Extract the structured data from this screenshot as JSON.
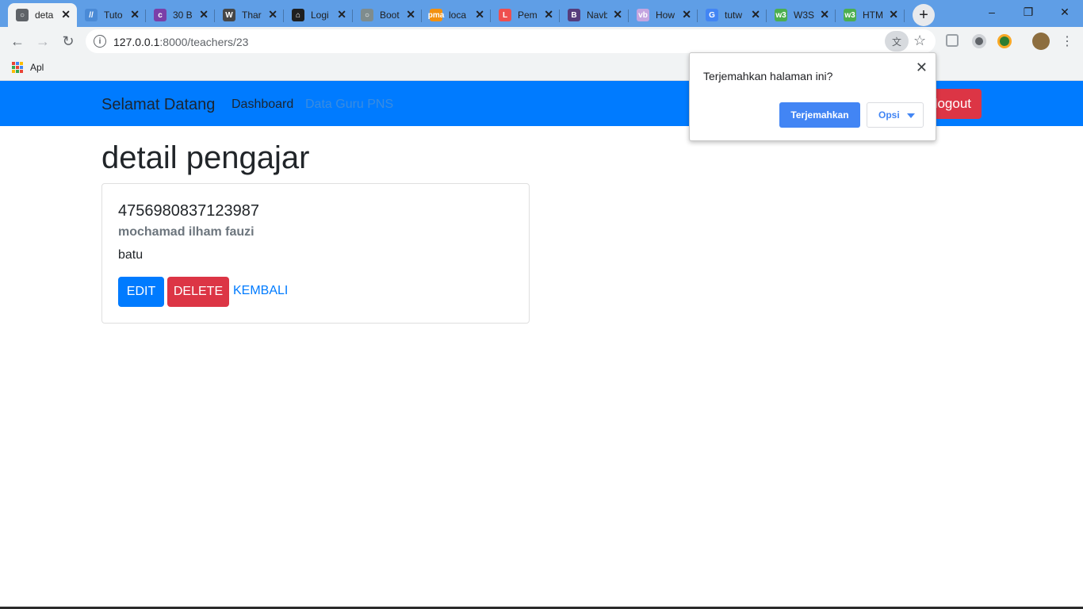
{
  "browser": {
    "tabs": [
      {
        "title": "deta",
        "icon": "globe-icon",
        "color": "#5f6368",
        "active": true
      },
      {
        "title": "Tuto",
        "icon": "wordpress-code-icon",
        "color": "#4a8ad6"
      },
      {
        "title": "30 B",
        "icon": "colorlib-icon",
        "color": "#7b3fa8"
      },
      {
        "title": "Thar",
        "icon": "wordpress-icon",
        "color": "#464646"
      },
      {
        "title": "Logi",
        "icon": "home-icon",
        "color": "#1f1f1f"
      },
      {
        "title": "Boot",
        "icon": "globe-icon",
        "color": "#7f8c8d"
      },
      {
        "title": "loca",
        "icon": "phpmyadmin-icon",
        "color": "#f29111"
      },
      {
        "title": "Pem",
        "icon": "laravel-icon",
        "color": "#ef4f4f"
      },
      {
        "title": "Navb",
        "icon": "bootstrap-icon",
        "color": "#563d7c"
      },
      {
        "title": "How",
        "icon": "vb-icon",
        "color": "#c4a5e0"
      },
      {
        "title": "tutw",
        "icon": "google-icon",
        "color": "#4285f4"
      },
      {
        "title": "W3S",
        "icon": "w3schools-icon",
        "color": "#4caf50"
      },
      {
        "title": "HTM",
        "icon": "w3schools-icon",
        "color": "#4caf50"
      }
    ],
    "url_host": "127.0.0.1",
    "url_rest": ":8000/teachers/23",
    "bookmarks_label": "Apl"
  },
  "navbar": {
    "brand": "Selamat Datang",
    "links": [
      {
        "label": "Dashboard",
        "color": "#1b2530"
      },
      {
        "label": "Data Guru PNS",
        "color": "#3a8ce0"
      }
    ],
    "logout_label": "logout"
  },
  "content": {
    "page_title": "detail pengajar",
    "card": {
      "nip": "4756980837123987",
      "name": "mochamad ilham fauzi",
      "address": "batu",
      "edit_label": "EDIT",
      "delete_label": "DELETE",
      "back_label": "KEMBALI"
    }
  },
  "translate_popup": {
    "question": "Terjemahkan halaman ini?",
    "primary_label": "Terjemahkan",
    "options_label": "Opsi"
  },
  "colors": {
    "primary": "#007bff",
    "danger": "#dc3545",
    "tabstrip": "#5f9ee6"
  }
}
